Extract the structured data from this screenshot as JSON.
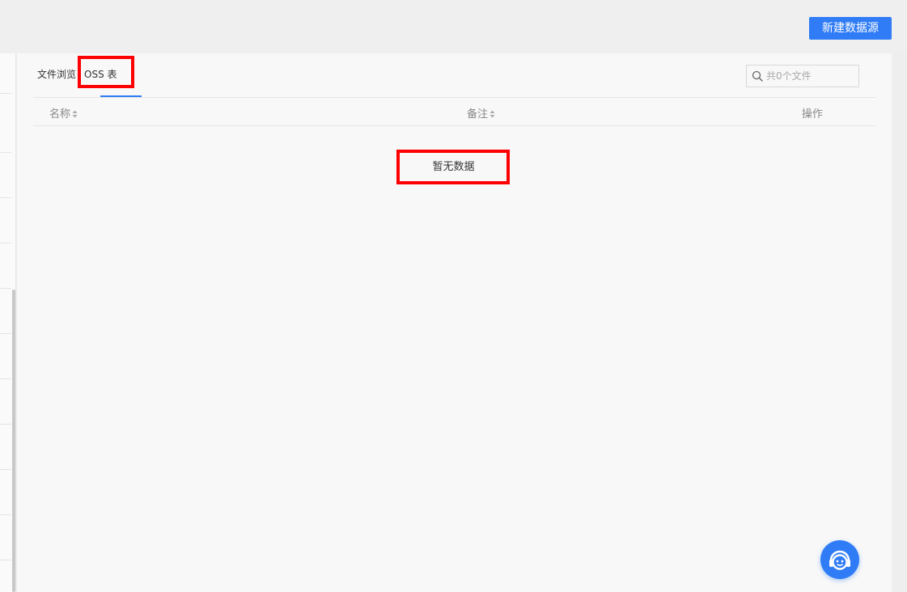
{
  "header": {
    "new_datasource_label": "新建数据源"
  },
  "tabs": [
    {
      "label": "文件浏览",
      "active": false
    },
    {
      "label": "OSS 表",
      "active": true
    }
  ],
  "search": {
    "placeholder": "共0个文件",
    "value": ""
  },
  "table": {
    "columns": [
      {
        "label": "名称",
        "sortable": true
      },
      {
        "label": "备注",
        "sortable": true
      },
      {
        "label": "操作",
        "sortable": false
      }
    ],
    "rows": [],
    "empty_text": "暂无数据"
  },
  "colors": {
    "accent": "#2f7cf6",
    "highlight_box": "#ff0000"
  },
  "icons": {
    "search": "search-icon",
    "sort": "sort-icon",
    "help": "customer-service-icon"
  }
}
